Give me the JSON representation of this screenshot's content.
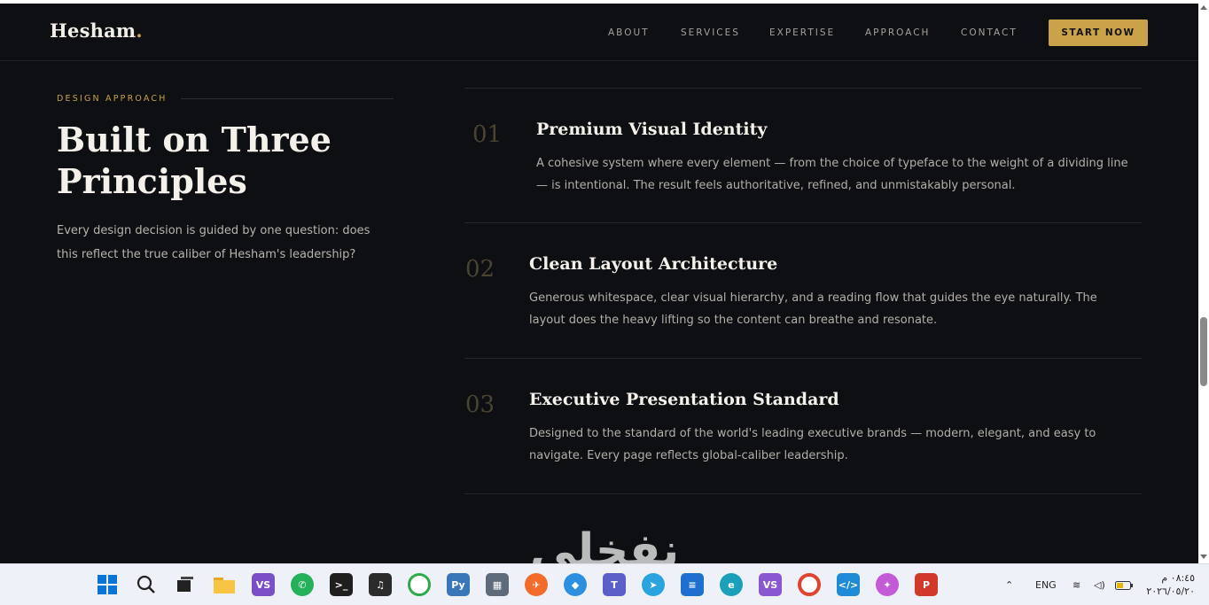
{
  "header": {
    "logo": "Hesham",
    "logo_dot": ".",
    "nav": [
      "ABOUT",
      "SERVICES",
      "EXPERTISE",
      "APPROACH",
      "CONTACT"
    ],
    "cta": "START NOW"
  },
  "intro": {
    "eyebrow": "DESIGN APPROACH",
    "title_line1": "Built on Three",
    "title_line2": "Principles",
    "lead": "Every design decision is guided by one question: does this reflect the true caliber of Hesham's leadership?"
  },
  "principles": [
    {
      "number": "01",
      "title": "Premium Visual Identity",
      "description": "A cohesive system where every element — from the choice of typeface to the weight of a dividing line — is intentional. The result feels authoritative, refined, and unmistakably personal."
    },
    {
      "number": "02",
      "title": "Clean Layout Architecture",
      "description": "Generous whitespace, clear visual hierarchy, and a reading flow that guides the eye naturally. The layout does the heavy lifting so the content can breathe and resonate."
    },
    {
      "number": "03",
      "title": "Executive Presentation Standard",
      "description": "Designed to the standard of the world's leading executive brands — modern, elegant, and easy to navigate. Every page reflects global-caliber leadership."
    }
  ],
  "watermark": "نفخلي",
  "taskbar": {
    "apps": [
      "windows-start",
      "search",
      "task-view",
      "file-explorer",
      "visual-studio",
      "whatsapp",
      "terminal",
      "piano-app",
      "sync-app",
      "python-ide",
      "calculator",
      "postman",
      "app-blue",
      "teams",
      "telegram",
      "azure-data-studio",
      "edge",
      "visual-studio-preview",
      "chrome",
      "vscode",
      "copilot",
      "powerpoint"
    ],
    "language": "ENG",
    "time": "٠٨:٤٥ م",
    "date": "٢٠٢٦/٠٥/٢٠"
  },
  "colors": {
    "background": "#0e0f13",
    "accent": "#c9a24a",
    "heading": "#f4f1ea",
    "body_text": "#b2afa9",
    "number": "#4a4433"
  }
}
